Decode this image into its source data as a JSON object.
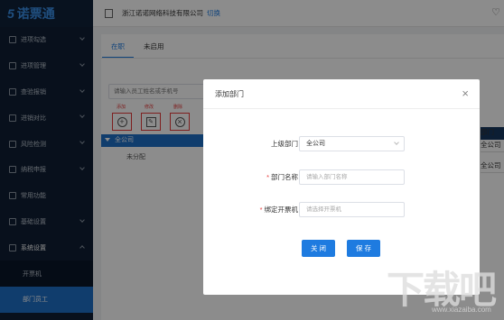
{
  "app": {
    "logo_mark": "5",
    "logo_text": "诺票通"
  },
  "sidebar": {
    "items": [
      {
        "label": "进项勾选"
      },
      {
        "label": "进项管理"
      },
      {
        "label": "查验报销"
      },
      {
        "label": "进销对比"
      },
      {
        "label": "风险检测"
      },
      {
        "label": "纳税申报"
      },
      {
        "label": "常用功能"
      },
      {
        "label": "基础设置"
      },
      {
        "label": "系统设置"
      }
    ],
    "sub_items": [
      {
        "label": "开票机"
      },
      {
        "label": "部门员工"
      }
    ]
  },
  "header": {
    "company": "浙江诺诺网络科技有限公司",
    "switch_label": "切换",
    "icon": "heart-icon"
  },
  "main": {
    "tabs": [
      {
        "label": "在职"
      },
      {
        "label": "未启用"
      }
    ],
    "search_placeholder": "请输入员工姓名或手机号",
    "toolbar": {
      "add_label": "添加",
      "edit_label": "修改",
      "delete_label": "删除"
    },
    "tree": {
      "root": "全公司",
      "child": "未分配"
    },
    "right_cells": [
      "部门",
      "全公司",
      "全公司"
    ]
  },
  "modal": {
    "title": "添加部门",
    "close_symbol": "×",
    "fields": {
      "parent_label": "上级部门",
      "parent_value": "全公司",
      "name_label": "部门名称",
      "name_placeholder": "请输入部门名称",
      "machine_label": "绑定开票机",
      "machine_placeholder": "请选择开票机",
      "required_mark": "*"
    },
    "close_button": "关 闭",
    "save_button": "保 存"
  },
  "watermark": {
    "text": "下载吧",
    "sub": "www.xiazaiba.com"
  },
  "colors": {
    "sidebar": "#0f1e33",
    "accent": "#1e7be0",
    "active": "#1e6fc7",
    "highlight": "#e63a3a"
  }
}
